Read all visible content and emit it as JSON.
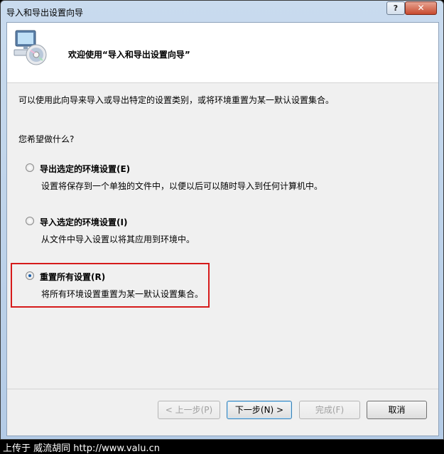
{
  "window": {
    "title": "导入和导出设置向导",
    "help_label": "?",
    "close_label": "✕"
  },
  "header": {
    "title": "欢迎使用“导入和导出设置向导”"
  },
  "intro": "可以使用此向导来导入或导出特定的设置类别，或将环境重置为某一默认设置集合。",
  "question": "您希望做什么?",
  "options": [
    {
      "label": "导出选定的环境设置(E)",
      "description": "设置将保存到一个单独的文件中，以便以后可以随时导入到任何计算机中。",
      "selected": false
    },
    {
      "label": "导入选定的环境设置(I)",
      "description": "从文件中导入设置以将其应用到环境中。",
      "selected": false
    },
    {
      "label": "重置所有设置(R)",
      "description": "将所有环境设置重置为某一默认设置集合。",
      "selected": true
    }
  ],
  "buttons": {
    "prev": "< 上一步(P)",
    "next": "下一步(N) >",
    "finish": "完成(F)",
    "cancel": "取消"
  },
  "caption": "上传于 威流胡同 http://www.valu.cn",
  "colors": {
    "highlight_border": "#d61a1a",
    "radio_dot": "#1b5ea8"
  }
}
